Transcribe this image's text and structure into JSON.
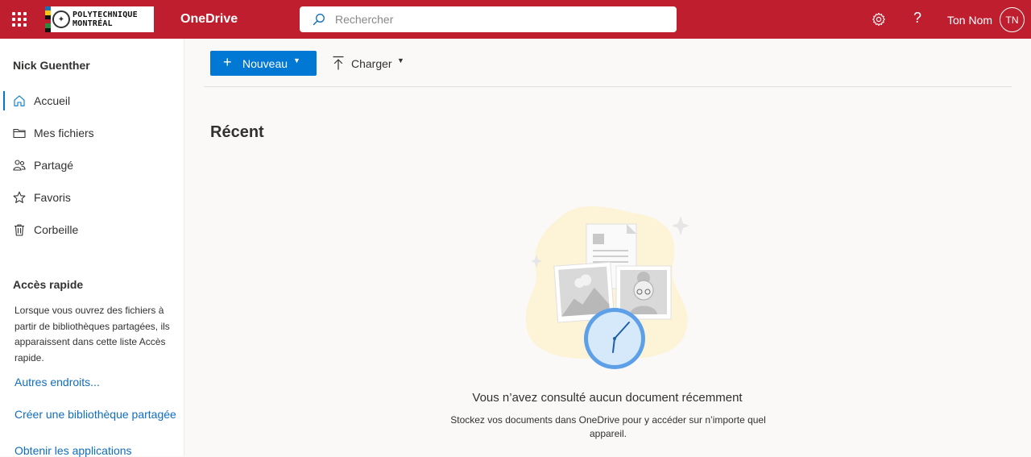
{
  "header": {
    "logo_line1": "POLYTECHNIQUE",
    "logo_line2": "MONTRÉAL",
    "app_name": "OneDrive",
    "search_placeholder": "Rechercher",
    "help_label": "?",
    "user_name": "Ton Nom",
    "avatar_initials": "TN",
    "bar_color": "#be1e2d"
  },
  "sidebar": {
    "owner": "Nick Guenther",
    "items": [
      {
        "label": "Accueil",
        "icon": "home-icon",
        "active": true
      },
      {
        "label": "Mes fichiers",
        "icon": "folder-icon"
      },
      {
        "label": "Partagé",
        "icon": "people-icon"
      },
      {
        "label": "Favoris",
        "icon": "star-icon"
      },
      {
        "label": "Corbeille",
        "icon": "trash-icon"
      }
    ],
    "quick_access_title": "Accès rapide",
    "quick_access_desc": "Lorsque vous ouvrez des fichiers à partir de bibliothèques partagées, ils apparaissent dans cette liste Accès rapide.",
    "more_places": "Autres endroits...",
    "create_library": "Créer une bibliothèque partagée",
    "get_apps": "Obtenir les applications"
  },
  "toolbar": {
    "new_label": "Nouveau",
    "upload_label": "Charger",
    "accent": "#0078d4"
  },
  "main": {
    "section_title": "Récent",
    "empty_title": "Vous n’avez consulté aucun document récemment",
    "empty_subtitle": "Stockez vos documents dans OneDrive pour y accéder sur n’importe quel appareil."
  }
}
